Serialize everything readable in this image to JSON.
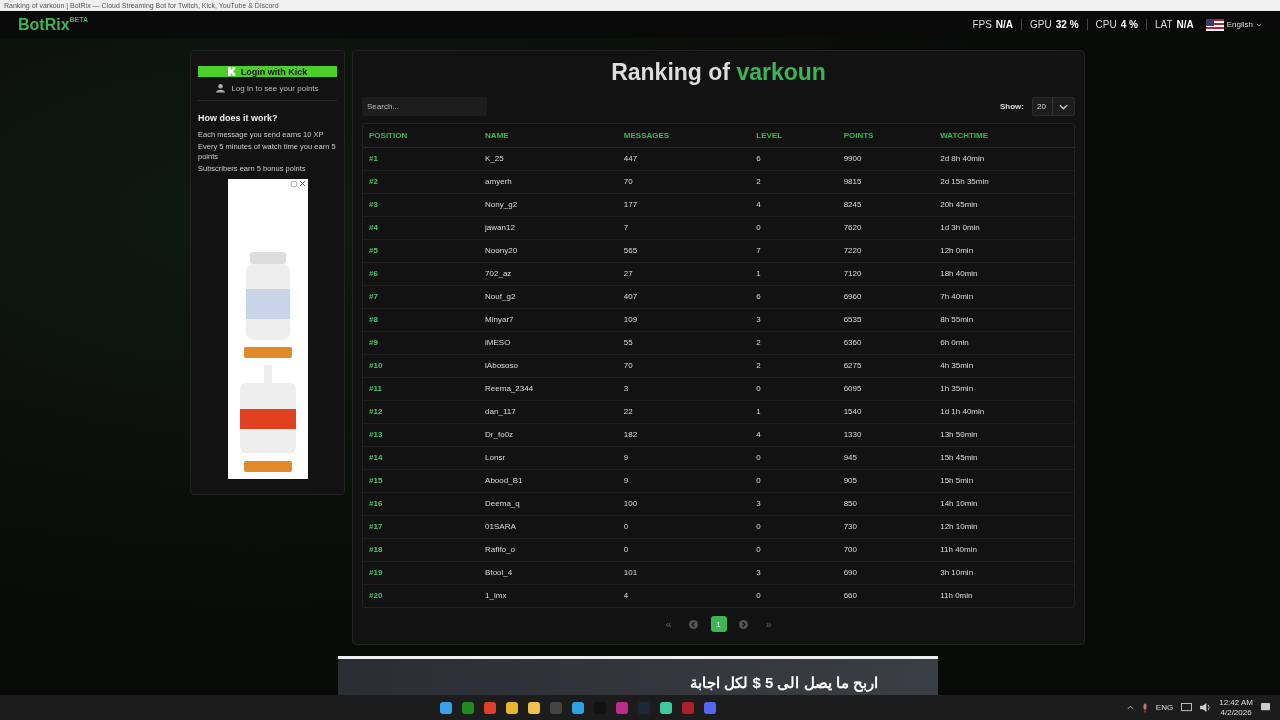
{
  "browser": {
    "title": "Ranking of varkoun | BotRix — Cloud Streaming Bot for Twitch, Kick, YouTube & Discord"
  },
  "header": {
    "logo": "BotRix",
    "logo_badge": "BETA",
    "language": "English",
    "stats": [
      {
        "label": "FPS",
        "value": "N/A"
      },
      {
        "label": "GPU",
        "value": "32 %"
      },
      {
        "label": "CPU",
        "value": "4 %"
      },
      {
        "label": "LAT",
        "value": "N/A"
      }
    ]
  },
  "sidebar": {
    "login_button": "Login with Kick",
    "login_hint": "Log in to see your points",
    "how_title": "How does it work?",
    "how_lines": [
      "Each message you send earns 10 XP",
      "Every 5 minutes of watch time you earn 5 points",
      "Subscribers earn 5 bonus points"
    ]
  },
  "ranking": {
    "title_prefix": "Ranking of",
    "channel": "varkoun",
    "search": {
      "placeholder": "Search..."
    },
    "show_label": "Show:",
    "show_value": "20",
    "columns": [
      "POSITION",
      "NAME",
      "MESSAGES",
      "LEVEL",
      "POINTS",
      "WATCHTIME"
    ],
    "rows": [
      [
        "#1",
        "K_25",
        "447",
        "6",
        "9900",
        "2d 8h 40min"
      ],
      [
        "#2",
        "amyerh",
        "70",
        "2",
        "9815",
        "2d 15h 35min"
      ],
      [
        "#3",
        "Nony_g2",
        "177",
        "4",
        "8245",
        "20h 45min"
      ],
      [
        "#4",
        "jawan12",
        "7",
        "0",
        "7620",
        "1d 3h 0min"
      ],
      [
        "#5",
        "Noony20",
        "565",
        "7",
        "7220",
        "12h 0min"
      ],
      [
        "#6",
        "702_az",
        "27",
        "1",
        "7120",
        "18h 40min"
      ],
      [
        "#7",
        "Nouf_g2",
        "407",
        "6",
        "6960",
        "7h 40min"
      ],
      [
        "#8",
        "Minyar7",
        "109",
        "3",
        "6535",
        "8h 55min"
      ],
      [
        "#9",
        "iMESO",
        "55",
        "2",
        "6360",
        "6h 0min"
      ],
      [
        "#10",
        "lAbososo",
        "70",
        "2",
        "6275",
        "4h 35min"
      ],
      [
        "#11",
        "Reema_2344",
        "3",
        "0",
        "6095",
        "1h 35min"
      ],
      [
        "#12",
        "dan_117",
        "22",
        "1",
        "1540",
        "1d 1h 40min"
      ],
      [
        "#13",
        "Dr_fo0z",
        "182",
        "4",
        "1330",
        "13h 50min"
      ],
      [
        "#14",
        "Lonsr",
        "9",
        "0",
        "945",
        "15h 45min"
      ],
      [
        "#15",
        "Abood_B1",
        "9",
        "0",
        "905",
        "15h 5min"
      ],
      [
        "#16",
        "Deema_q",
        "100",
        "3",
        "850",
        "14h 10min"
      ],
      [
        "#17",
        "01SARA",
        "0",
        "0",
        "730",
        "12h 10min"
      ],
      [
        "#18",
        "Rafifo_o",
        "0",
        "0",
        "700",
        "11h 40min"
      ],
      [
        "#19",
        "Btool_4",
        "101",
        "3",
        "690",
        "3h 10min"
      ],
      [
        "#20",
        "1_imx",
        "4",
        "0",
        "660",
        "11h 0min"
      ]
    ],
    "pagination": {
      "first": "«",
      "last": "»",
      "pages": [
        {
          "label": "1",
          "selected": true
        }
      ]
    }
  },
  "bottom_ad": {
    "text": "اربح ما يصل الى 5 $ لكل اجابة"
  },
  "taskbar": {
    "language": "ENG",
    "time": "12:42 AM",
    "date": "4/2/2026"
  }
}
